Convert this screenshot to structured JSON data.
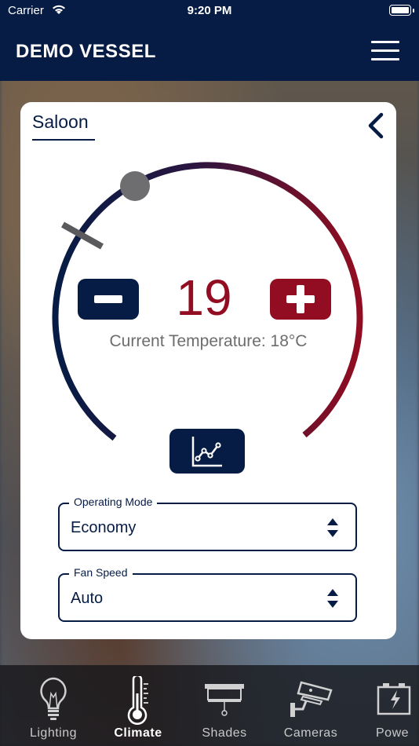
{
  "status_bar": {
    "carrier": "Carrier",
    "time": "9:20 PM"
  },
  "header": {
    "title": "DEMO VESSEL"
  },
  "room": {
    "name": "Saloon"
  },
  "climate": {
    "setpoint": "19",
    "current_temperature": "Current Temperature: 18°C"
  },
  "operating_mode": {
    "label": "Operating Mode",
    "value": "Economy"
  },
  "fan_speed": {
    "label": "Fan Speed",
    "value": "Auto"
  },
  "tabs": [
    {
      "label": "Lighting",
      "icon": "lightbulb-icon"
    },
    {
      "label": "Climate",
      "icon": "thermometer-icon",
      "active": true
    },
    {
      "label": "Shades",
      "icon": "shade-icon"
    },
    {
      "label": "Cameras",
      "icon": "camera-icon"
    },
    {
      "label": "Powe",
      "icon": "battery-icon"
    }
  ],
  "colors": {
    "navy": "#061c45",
    "red": "#920d21",
    "knob": "#6e6e70",
    "marker": "#5a5a5c"
  }
}
